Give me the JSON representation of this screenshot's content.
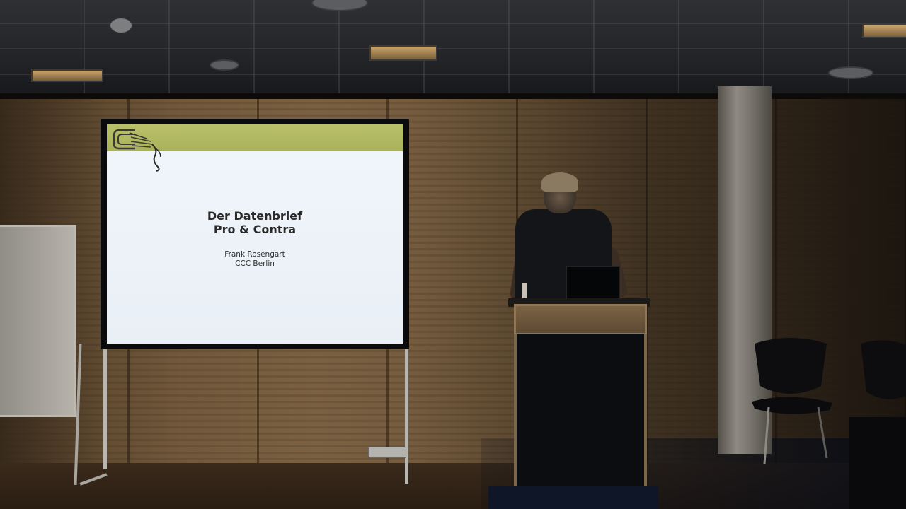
{
  "scene": {
    "description_kind": "conference talk photo"
  },
  "slide": {
    "title_line1": "Der Datenbrief",
    "title_line2": "Pro & Contra",
    "author": "Frank Rosengart",
    "organization": "CCC Berlin",
    "header_color": "#b1b860",
    "logo_icon": "ccc-logo-icon"
  }
}
